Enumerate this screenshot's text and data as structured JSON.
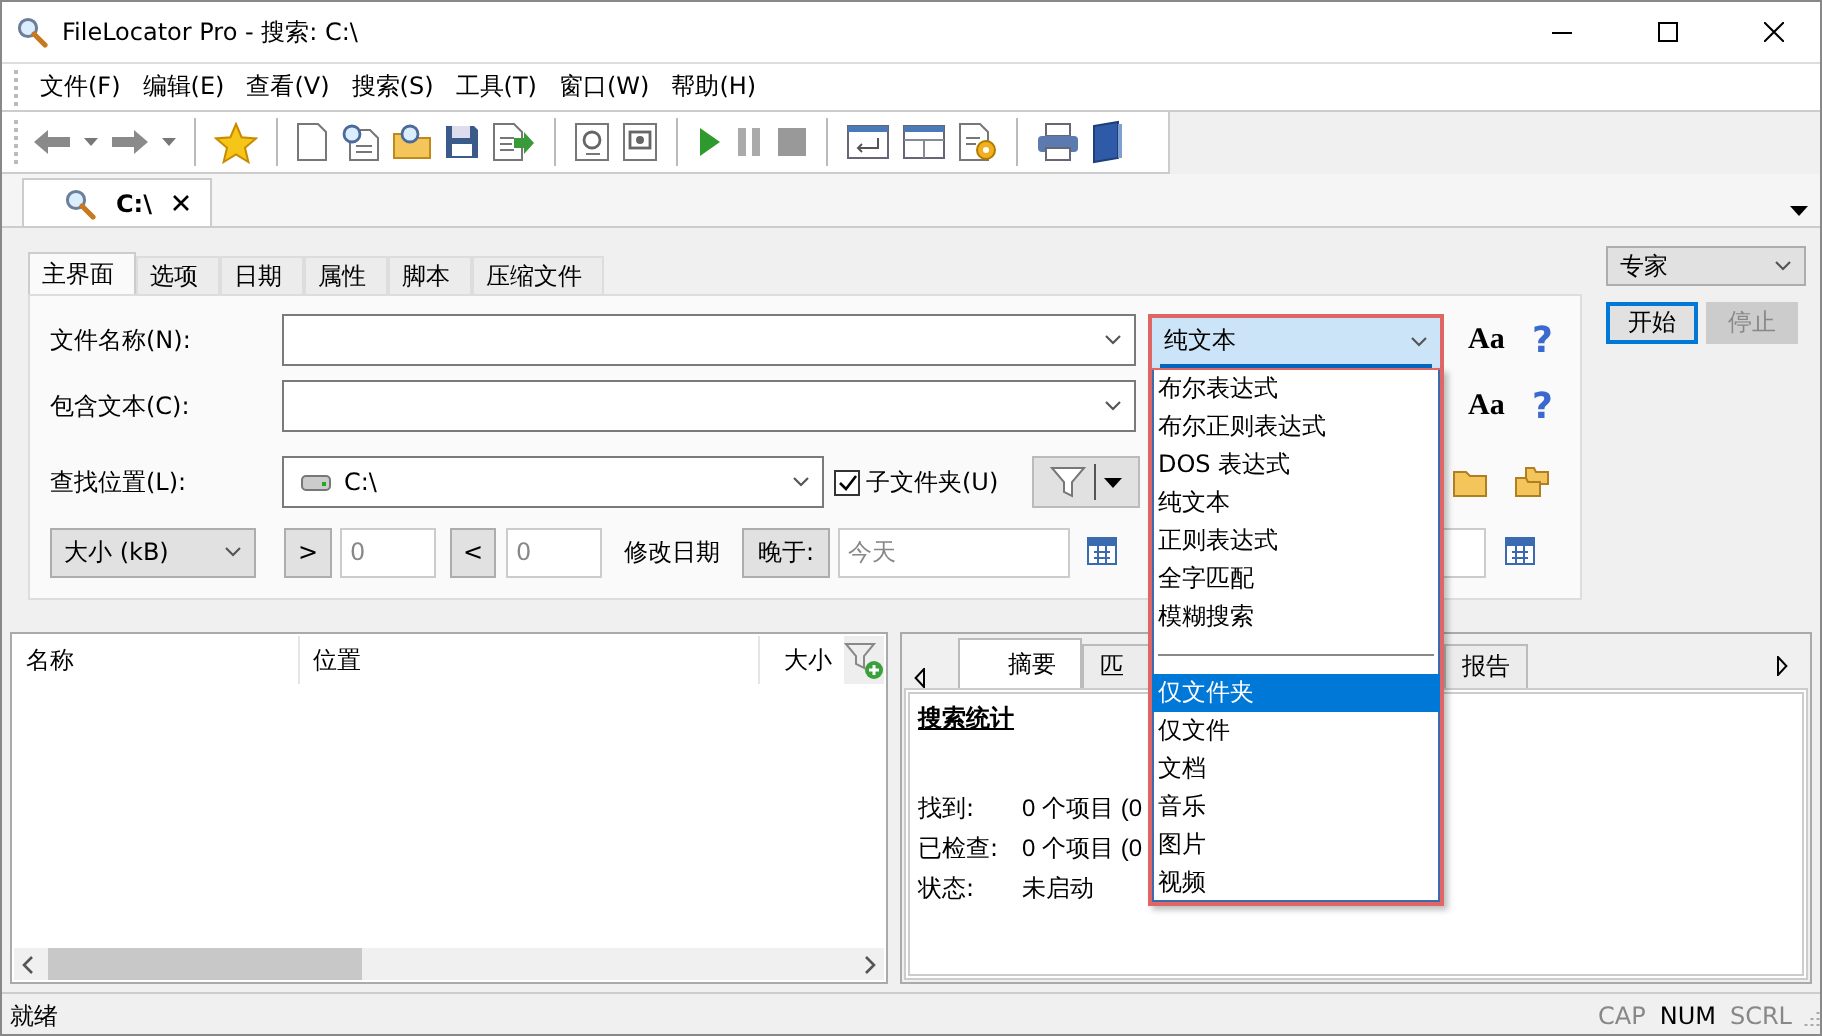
{
  "window": {
    "title": "FileLocator Pro - 搜索: C:\\"
  },
  "menu": [
    "文件(F)",
    "编辑(E)",
    "查看(V)",
    "搜索(S)",
    "工具(T)",
    "窗口(W)",
    "帮助(H)"
  ],
  "doc_tabs": [
    {
      "label": "C:\\",
      "selected": true
    }
  ],
  "search_tabs": [
    {
      "label": "主界面",
      "selected": true
    },
    {
      "label": "选项",
      "selected": false
    },
    {
      "label": "日期",
      "selected": false
    },
    {
      "label": "属性",
      "selected": false
    },
    {
      "label": "脚本",
      "selected": false
    },
    {
      "label": "压缩文件",
      "selected": false
    }
  ],
  "form": {
    "file_name_label": "文件名称(N):",
    "contains_text_label": "包含文本(C):",
    "look_in_label": "查找位置(L):",
    "look_in_value": "C:\\",
    "match_type": {
      "value": "纯文本",
      "expanded": true
    },
    "file_name_case_button": "Aa",
    "file_name_help_button": "?",
    "contains_text_case_button": "Aa",
    "contains_text_help_button": "?",
    "subfolders": {
      "label": "子文件夹(U)",
      "checked": true
    },
    "size_select": "大小 (kB)",
    "greater_button": ">",
    "greater_value": "0",
    "less_button": "<",
    "less_value": "0",
    "date_label": "修改日期",
    "date_op_button": "晚于:",
    "date_value": "今天"
  },
  "dropdown": {
    "items": [
      {
        "kind": "option",
        "label": "布尔表达式",
        "selected": false
      },
      {
        "kind": "option",
        "label": "布尔正则表达式",
        "selected": false
      },
      {
        "kind": "option",
        "label": "DOS 表达式",
        "selected": false
      },
      {
        "kind": "option",
        "label": "纯文本",
        "selected": false
      },
      {
        "kind": "option",
        "label": "正则表达式",
        "selected": false
      },
      {
        "kind": "option",
        "label": "全字匹配",
        "selected": false
      },
      {
        "kind": "option",
        "label": "模糊搜索",
        "selected": false
      },
      {
        "kind": "separator"
      },
      {
        "kind": "option",
        "label": "仅文件夹",
        "selected": true
      },
      {
        "kind": "option",
        "label": "仅文件",
        "selected": false
      },
      {
        "kind": "option",
        "label": "文档",
        "selected": false
      },
      {
        "kind": "option",
        "label": "音乐",
        "selected": false
      },
      {
        "kind": "option",
        "label": "图片",
        "selected": false
      },
      {
        "kind": "option",
        "label": "视频",
        "selected": false
      }
    ]
  },
  "mode_select": "专家",
  "start_button": {
    "label": "开始",
    "disabled": false
  },
  "stop_button": {
    "label": "停止",
    "disabled": true
  },
  "results_table": {
    "columns": [
      "名称",
      "位置",
      "大小"
    ]
  },
  "summary_tabs": [
    {
      "label": "摘要",
      "selected": true
    },
    {
      "label": "匹",
      "selected": false
    },
    {
      "label": "报告",
      "selected": false
    }
  ],
  "summary": {
    "heading": "搜索统计",
    "rows": [
      {
        "label": "找到:",
        "value": "0 个项目 (0"
      },
      {
        "label": "已检查:",
        "value": "0 个项目 (0"
      },
      {
        "label": "状态:",
        "value": "未启动"
      }
    ]
  },
  "status_bar": {
    "text": "就绪",
    "indicators": [
      {
        "label": "CAP",
        "on": false
      },
      {
        "label": "NUM",
        "on": true
      },
      {
        "label": "SCRL",
        "on": false
      }
    ]
  }
}
